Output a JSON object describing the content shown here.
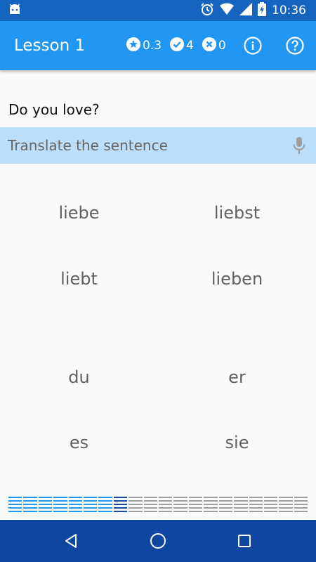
{
  "status_bar": {
    "time": "10:36",
    "icons": [
      "android-icon",
      "alarm-icon",
      "wifi-icon",
      "signal-icon",
      "battery-charging-icon"
    ]
  },
  "app_bar": {
    "title": "Lesson 1",
    "stats": {
      "score": "0.3",
      "correct": "4",
      "wrong": "0"
    },
    "actions": [
      "info-icon",
      "help-icon"
    ]
  },
  "exercise": {
    "question": "Do you love?",
    "answer_placeholder": "Translate the sentence",
    "answer_value": ""
  },
  "word_choices": [
    [
      "liebe",
      "liebst"
    ],
    [
      "liebt",
      "lieben"
    ],
    [
      "du",
      "er"
    ],
    [
      "es",
      "sie"
    ]
  ],
  "progress": {
    "total_segments": 20,
    "completed_segments": 7,
    "current_segment": 8
  },
  "colors": {
    "status_bar": "#1565c0",
    "app_bar": "#2196f3",
    "answer_bar": "#bbdefb",
    "nav_bar": "#0d47a1",
    "progress_done": "#2196f3",
    "progress_current": "#1a47a8",
    "progress_todo": "#9e9e9e"
  },
  "nav_bar": {
    "buttons": [
      "back-icon",
      "home-icon",
      "recents-icon"
    ]
  }
}
